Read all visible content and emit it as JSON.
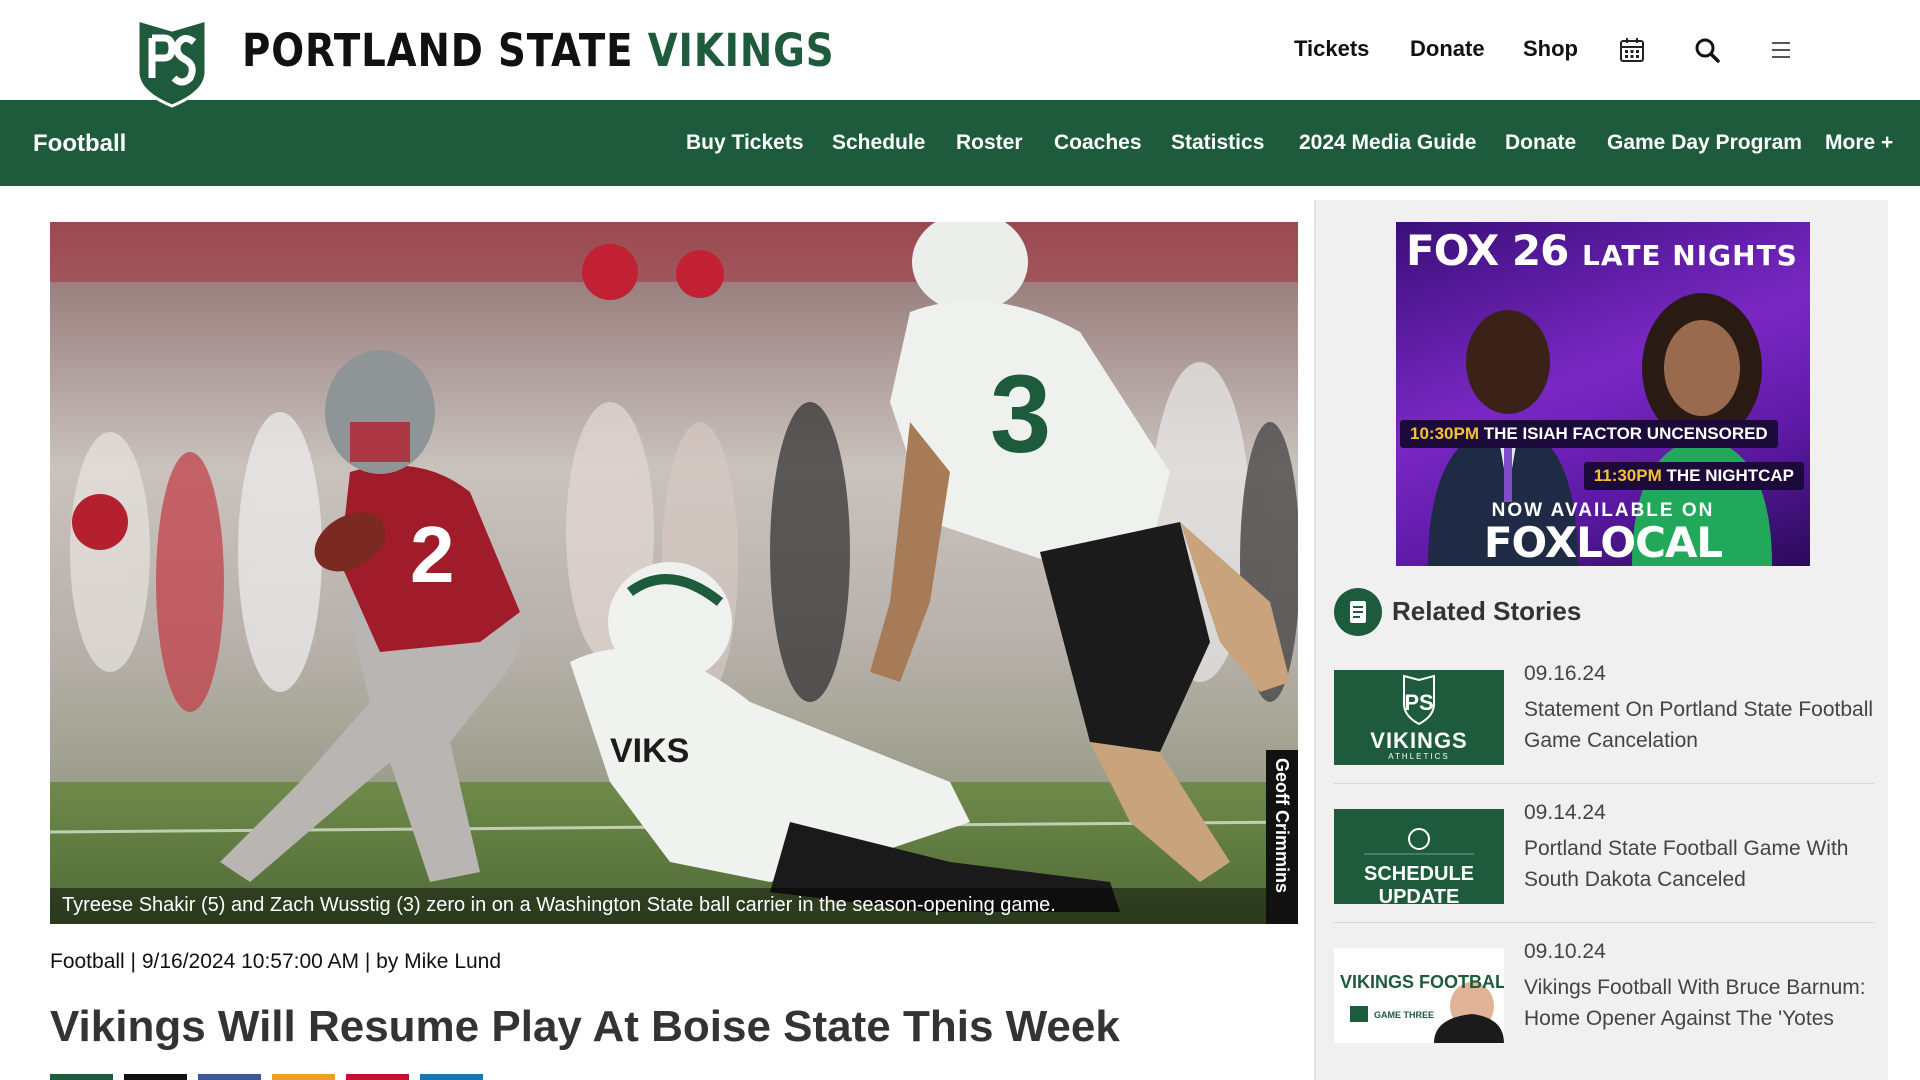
{
  "header": {
    "brand_part1": "PORTLAND STATE",
    "brand_part2": "VIKINGS",
    "links": [
      "Tickets",
      "Donate",
      "Shop"
    ],
    "icons": [
      "calendar-icon",
      "search-icon",
      "menu-icon"
    ]
  },
  "nav": {
    "title": "Football",
    "items": [
      "Buy Tickets",
      "Schedule",
      "Roster",
      "Coaches",
      "Statistics",
      "2024 Media Guide",
      "Donate",
      "Game Day Program",
      "More +"
    ]
  },
  "article": {
    "photo_credit": "Geoff Crimmins",
    "caption": "Tyreese Shakir (5) and Zach Wusstig (3) zero in on a Washington State ball carrier in the season-opening game.",
    "meta": "Football | 9/16/2024 10:57:00 AM | by Mike Lund",
    "headline": "Vikings Will Resume Play At Boise State This Week",
    "share_colors": [
      "#1d5b3c",
      "#111111",
      "#3b5998",
      "#f0a020",
      "#c8102e",
      "#1a75b5"
    ]
  },
  "ad": {
    "fox26": "FOX 26",
    "late_nights": "LATE NIGHTS",
    "show1_time": "10:30PM",
    "show1_name": "THE ISIAH FACTOR UNCENSORED",
    "show2_time": "11:30PM",
    "show2_name": "THE NIGHTCAP",
    "now_available": "NOW AVAILABLE ON",
    "fox_local": "FOXLOCAL"
  },
  "related": {
    "title": "Related Stories",
    "stories": [
      {
        "date": "09.16.24",
        "title": "Statement On Portland State Football Game Cancelation",
        "thumb_text": "VIKINGS",
        "thumb_sub": "ATHLETICS"
      },
      {
        "date": "09.14.24",
        "title": "Portland State Football Game With South Dakota Canceled",
        "thumb_text": "SCHEDULE UPDATE",
        "thumb_sub": ""
      },
      {
        "date": "09.10.24",
        "title": "Vikings Football With Bruce Barnum: Home Opener Against The 'Yotes",
        "thumb_text": "VIKINGS FOOTBALL",
        "thumb_sub": "GAME THREE"
      }
    ]
  },
  "colors": {
    "brand_green": "#1d5b3c",
    "sidebar_bg": "#f0f0f0"
  }
}
